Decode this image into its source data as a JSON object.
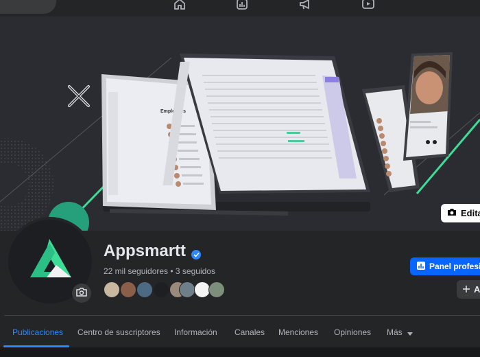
{
  "nav": {
    "icons": [
      "home-icon",
      "chart-icon",
      "megaphone-icon",
      "video-icon"
    ]
  },
  "cover": {
    "edit_label": "Editar",
    "illustration": {
      "employees_heading": "Employees"
    }
  },
  "profile": {
    "name": "Appsmartt",
    "stats": "22 mil seguidores • 3 seguidos",
    "verified": true,
    "friends_count": 8
  },
  "actions": {
    "panel_label": "Panel profesional",
    "add_label": "A"
  },
  "tabs": [
    {
      "label": "Publicaciones",
      "active": true
    },
    {
      "label": "Centro de suscriptores"
    },
    {
      "label": "Información"
    },
    {
      "label": "Canales"
    },
    {
      "label": "Menciones"
    },
    {
      "label": "Opiniones"
    },
    {
      "label": "Más"
    }
  ],
  "colors": {
    "accent": "#2d88ff",
    "brand_green": "#3ddc97",
    "panel_bg": "#242526",
    "page_bg": "#18191a"
  }
}
